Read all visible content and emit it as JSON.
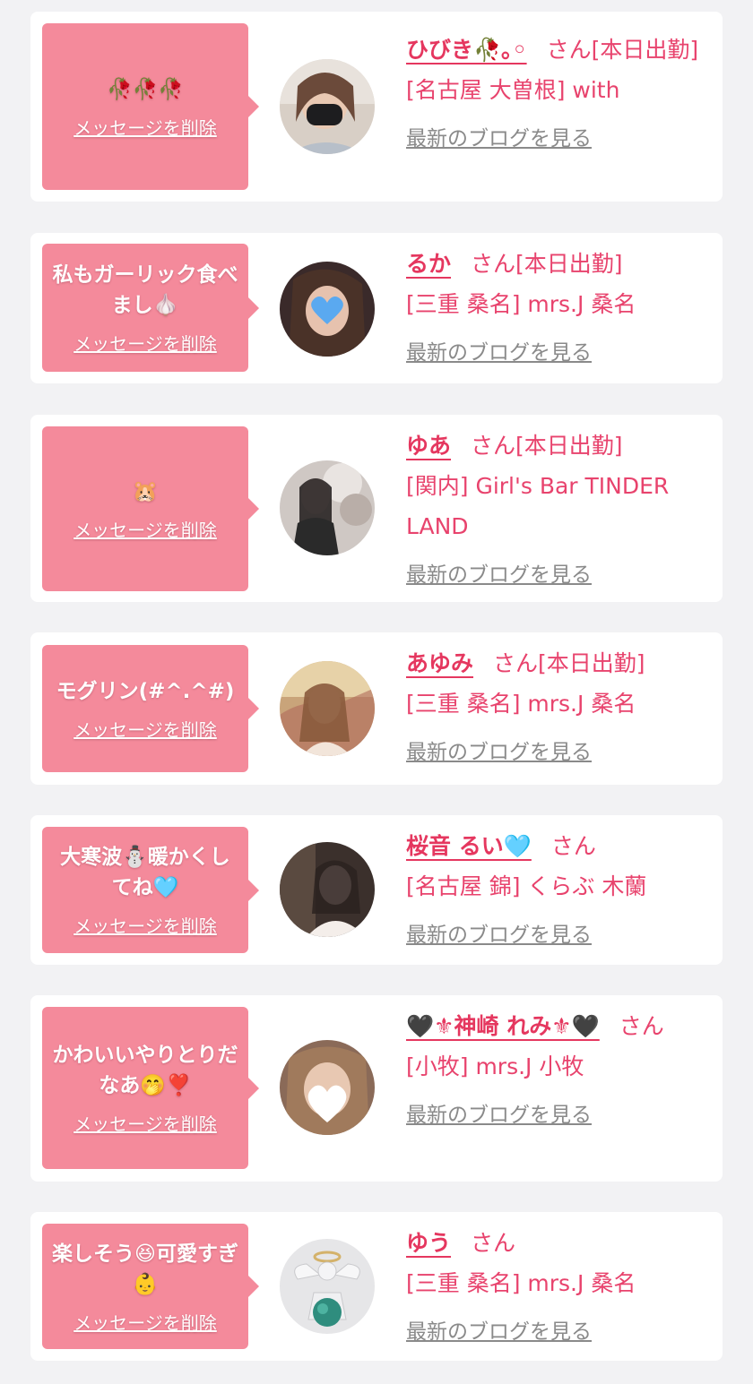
{
  "delete_label": "メッセージを削除",
  "blog_label": "最新のブログを見る",
  "san_label": "さん",
  "colors": {
    "bubble": "#f48a9b",
    "accent": "#e8436d",
    "link_gray": "#8a8a8a",
    "background": "#f2f2f4"
  },
  "cards": [
    {
      "message": "🥀🥀🥀",
      "name": "ひびき🥀｡◦",
      "status": "[本日出勤]",
      "shop": "[名古屋 大曽根] with"
    },
    {
      "message": "私もガーリック食べまし🧄",
      "name": "るか",
      "status": "[本日出勤]",
      "shop": "[三重 桑名] mrs.J 桑名"
    },
    {
      "message": "🐹",
      "name": "ゆあ",
      "status": "[本日出勤]",
      "shop": "[関内] Girl's Bar TINDER LAND"
    },
    {
      "message": "モグリン(#^.^#)",
      "name": "あゆみ",
      "status": "[本日出勤]",
      "shop": "[三重 桑名] mrs.J 桑名"
    },
    {
      "message": "大寒波⛄暖かくしてね🩵",
      "name": "桜音 るい🩵",
      "status": "",
      "shop": "[名古屋 錦] くらぶ 木蘭"
    },
    {
      "message": "かわいいやりとりだなあ🤭❣️",
      "name": "🖤⚜神崎 れみ⚜🖤",
      "status": "",
      "shop": "[小牧] mrs.J 小牧"
    },
    {
      "message": "楽しそう😆可愛すぎ👶",
      "name": "ゆう",
      "status": "",
      "shop": "[三重 桑名] mrs.J 桑名"
    }
  ]
}
